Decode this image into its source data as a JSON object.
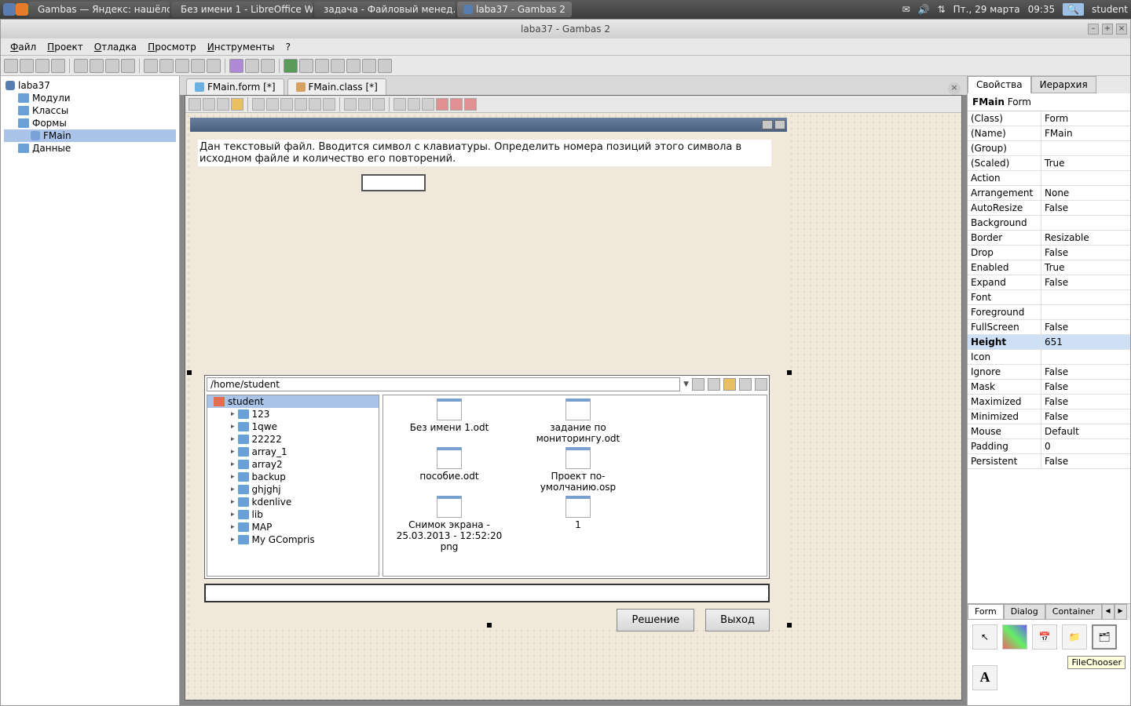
{
  "sysbar": {
    "tasks": [
      "Gambas — Яндекс: нашёлс…",
      "Без имени 1 - LibreOffice W…",
      "задача - Файловый менед…",
      "laba37 - Gambas 2"
    ],
    "date": "Пт., 29 марта",
    "time": "09:35",
    "user": "student"
  },
  "window": {
    "title": "laba37 - Gambas 2"
  },
  "menu": [
    "Файл",
    "Проект",
    "Отладка",
    "Просмотр",
    "Инструменты",
    "?"
  ],
  "project": {
    "root": "laba37",
    "folders": [
      "Модули",
      "Классы",
      "Формы",
      "Данные"
    ],
    "forms": [
      "FMain"
    ]
  },
  "editorTabs": [
    "FMain.form [*]",
    "FMain.class [*]"
  ],
  "form": {
    "task_text": "Дан текстовый файл. Вводится символ с клавиатуры. Определить номера позиций этого символа в исходном файле и количество его повторений.",
    "path": "/home/student",
    "tree_root": "student",
    "tree_items": [
      "123",
      "1qwe",
      "22222",
      "array_1",
      "array2",
      "backup",
      "ghjghj",
      "kdenlive",
      "lib",
      "MAP",
      "My GCompris"
    ],
    "files": [
      "Без имени 1.odt",
      "задание по мониторингу.odt",
      "пособие.odt",
      "Проект по-умолчанию.osp",
      "Снимок экрана - 25.03.2013 - 12:52:20 png",
      "1"
    ],
    "btn_solve": "Решение",
    "btn_exit": "Выход"
  },
  "propTabs": [
    "Свойства",
    "Иерархия"
  ],
  "propHeader": {
    "name": "FMain",
    "type": "Form"
  },
  "properties": [
    {
      "k": "(Class)",
      "v": "Form"
    },
    {
      "k": "(Name)",
      "v": "FMain"
    },
    {
      "k": "(Group)",
      "v": ""
    },
    {
      "k": "(Scaled)",
      "v": "True"
    },
    {
      "k": "Action",
      "v": ""
    },
    {
      "k": "Arrangement",
      "v": "None"
    },
    {
      "k": "AutoResize",
      "v": "False"
    },
    {
      "k": "Background",
      "v": ""
    },
    {
      "k": "Border",
      "v": "Resizable"
    },
    {
      "k": "Drop",
      "v": "False"
    },
    {
      "k": "Enabled",
      "v": "True"
    },
    {
      "k": "Expand",
      "v": "False"
    },
    {
      "k": "Font",
      "v": ""
    },
    {
      "k": "Foreground",
      "v": ""
    },
    {
      "k": "FullScreen",
      "v": "False"
    },
    {
      "k": "Height",
      "v": "651",
      "sel": true
    },
    {
      "k": "Icon",
      "v": ""
    },
    {
      "k": "Ignore",
      "v": "False"
    },
    {
      "k": "Mask",
      "v": "False"
    },
    {
      "k": "Maximized",
      "v": "False"
    },
    {
      "k": "Minimized",
      "v": "False"
    },
    {
      "k": "Mouse",
      "v": "Default"
    },
    {
      "k": "Padding",
      "v": "0"
    },
    {
      "k": "Persistent",
      "v": "False"
    }
  ],
  "toolbox": {
    "tabs": [
      "Form",
      "Dialog",
      "Container"
    ],
    "tooltip": "FileChooser"
  }
}
